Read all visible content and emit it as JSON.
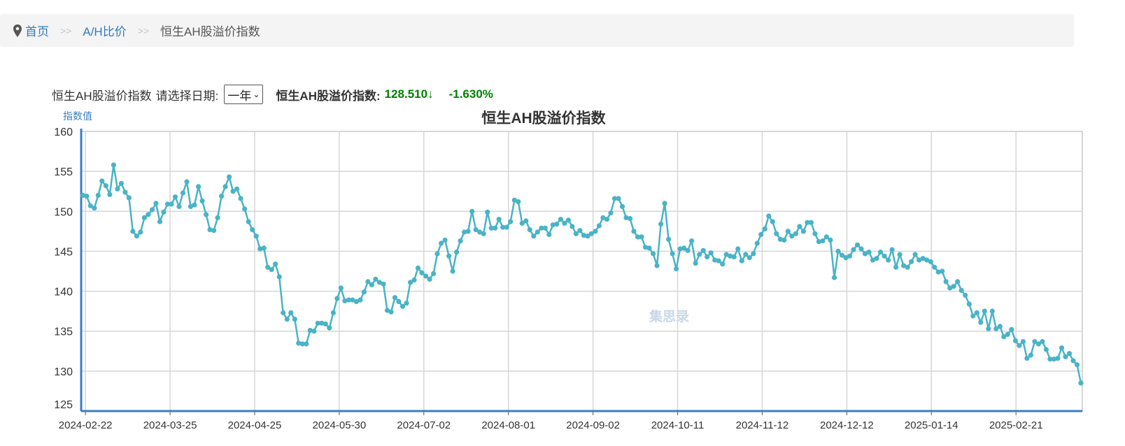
{
  "breadcrumb": {
    "icon": "map-marker-icon",
    "home": "首页",
    "separator": ">>",
    "section": "A/H比价",
    "current": "恒生AH股溢价指数"
  },
  "controls": {
    "index_name": "恒生AH股溢价指数",
    "date_prompt": "请选择日期:",
    "date_range_selected": "一年",
    "summary_label": "恒生AH股溢价指数:",
    "current_value": "128.510↓",
    "change_pct": "-1.630%"
  },
  "watermark": "集思录",
  "colors": {
    "line": "#4ab3c6",
    "axis": "#3a7fc1",
    "grid": "#d6d6d6",
    "down": "#008000"
  },
  "chart_data": {
    "type": "line",
    "title": "恒生AH股溢价指数",
    "ylabel": "指数值",
    "xlabel": "",
    "ylim": [
      125,
      160
    ],
    "yticks": [
      160,
      155,
      150,
      145,
      140,
      135,
      130,
      125
    ],
    "xtick_labels": [
      "2024-02-22",
      "2024-03-25",
      "2024-04-25",
      "2024-05-30",
      "2024-07-02",
      "2024-08-01",
      "2024-09-02",
      "2024-10-11",
      "2024-11-12",
      "2024-12-12",
      "2025-01-14",
      "2025-02-21"
    ],
    "grid": true,
    "series": [
      {
        "name": "恒生AH股溢价指数",
        "values": [
          152.0,
          151.9,
          150.7,
          150.4,
          152.0,
          153.8,
          153.2,
          152.1,
          155.8,
          152.8,
          153.5,
          152.4,
          151.7,
          147.5,
          146.9,
          147.4,
          149.2,
          149.6,
          150.2,
          151.0,
          148.7,
          149.9,
          150.9,
          150.9,
          151.8,
          150.6,
          152.3,
          153.7,
          150.6,
          150.8,
          153.1,
          151.3,
          149.6,
          147.7,
          147.6,
          149.2,
          151.9,
          153.1,
          154.3,
          152.5,
          152.8,
          151.6,
          150.3,
          148.7,
          147.7,
          146.9,
          145.3,
          145.4,
          143.0,
          142.7,
          143.4,
          141.8,
          137.3,
          136.5,
          137.3,
          136.5,
          133.5,
          133.4,
          133.4,
          135.1,
          135.0,
          136.0,
          136.0,
          135.9,
          135.4,
          137.3,
          139.1,
          140.4,
          138.8,
          138.9,
          138.9,
          138.7,
          138.9,
          139.9,
          141.2,
          140.8,
          141.5,
          141.1,
          140.9,
          137.6,
          137.4,
          139.2,
          138.7,
          138.1,
          138.5,
          141.1,
          141.4,
          142.9,
          142.3,
          141.9,
          141.5,
          142.2,
          144.7,
          146.0,
          146.4,
          144.4,
          142.5,
          144.9,
          146.3,
          147.4,
          147.5,
          150.0,
          147.7,
          147.4,
          147.2,
          149.9,
          147.9,
          147.9,
          149.0,
          148.0,
          148.0,
          148.7,
          151.4,
          151.2,
          148.5,
          148.8,
          147.7,
          146.9,
          147.4,
          147.9,
          147.9,
          147.1,
          148.3,
          148.4,
          149.0,
          148.5,
          148.9,
          148.1,
          147.2,
          147.6,
          147.0,
          146.9,
          147.2,
          147.5,
          148.2,
          149.2,
          149.0,
          149.8,
          151.6,
          151.6,
          150.6,
          149.2,
          149.1,
          147.5,
          146.8,
          146.8,
          145.5,
          145.4,
          144.7,
          143.2,
          148.4,
          151.0,
          146.5,
          144.7,
          142.8,
          145.3,
          145.4,
          145.1,
          146.3,
          143.5,
          144.6,
          145.1,
          144.3,
          144.8,
          143.9,
          143.8,
          143.4,
          144.6,
          144.4,
          144.3,
          145.3,
          143.8,
          144.6,
          144.2,
          144.7,
          146.0,
          147.1,
          147.8,
          149.4,
          148.7,
          147.2,
          146.5,
          146.4,
          147.5,
          146.9,
          147.2,
          148.1,
          147.5,
          148.6,
          148.6,
          147.2,
          146.2,
          146.3,
          146.8,
          146.4,
          141.7,
          145.0,
          144.5,
          144.2,
          144.4,
          145.2,
          145.8,
          145.3,
          144.7,
          144.9,
          143.9,
          144.1,
          144.9,
          144.4,
          143.9,
          145.2,
          143.0,
          144.6,
          143.2,
          143.0,
          143.7,
          144.6,
          143.9,
          144.1,
          143.9,
          143.7,
          143.0,
          142.4,
          142.5,
          141.2,
          140.4,
          140.6,
          141.2,
          140.1,
          139.5,
          138.4,
          136.9,
          137.3,
          136.1,
          137.5,
          135.3,
          137.5,
          135.3,
          135.6,
          134.3,
          134.6,
          135.2,
          133.8,
          133.2,
          133.7,
          131.6,
          132.0,
          133.7,
          133.4,
          133.7,
          132.7,
          131.5,
          131.5,
          131.6,
          132.9,
          131.8,
          132.2,
          131.3,
          130.8,
          128.51
        ]
      }
    ]
  }
}
